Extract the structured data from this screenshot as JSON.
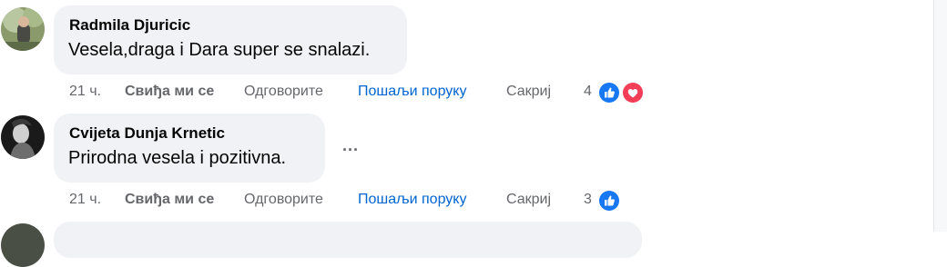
{
  "comments": [
    {
      "author": "Radmila Djuricic",
      "text": "Vesela,draga i Dara super se snalazi.",
      "time": "21 ч.",
      "like_label": "Свиђа ми се",
      "reply_label": "Одговорите",
      "message_label": "Пошаљи поруку",
      "hide_label": "Сакриј",
      "reaction_count": "4",
      "reactions": [
        "like-icon",
        "heart-icon"
      ]
    },
    {
      "author": "Cvijeta Dunja Krnetic",
      "text": "Prirodna vesela i pozitivna.",
      "time": "21 ч.",
      "like_label": "Свиђа ми се",
      "reply_label": "Одговорите",
      "message_label": "Пошаљи поруку",
      "hide_label": "Сакриј",
      "reaction_count": "3",
      "reactions": [
        "like-icon"
      ],
      "more_label": "..."
    }
  ],
  "colors": {
    "bubble": "#f0f2f5",
    "secondary_text": "#65676b",
    "link_blue": "#0064d1",
    "like_blue": "#1877f2",
    "heart_red": "#f33e58"
  }
}
